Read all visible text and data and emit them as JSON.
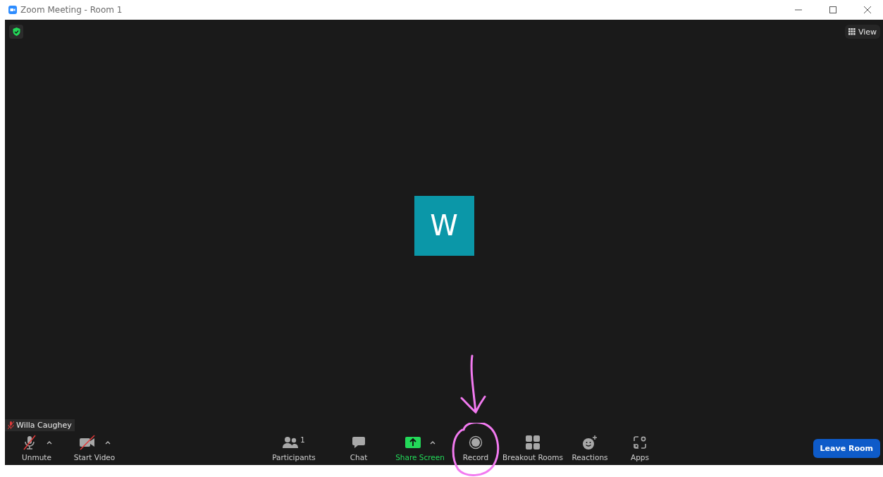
{
  "window": {
    "title": "Zoom Meeting - Room 1"
  },
  "view_button": {
    "label": "View"
  },
  "participant_tile": {
    "initial": "W"
  },
  "name_tag": {
    "name": "Willa Caughey",
    "muted": true
  },
  "toolbar": {
    "left": [
      {
        "kind": "mic",
        "label": "Unmute",
        "off": true,
        "menu": true
      },
      {
        "kind": "video",
        "label": "Start Video",
        "off": true,
        "menu": true
      }
    ],
    "center": [
      {
        "kind": "participants",
        "label": "Participants",
        "count": "1",
        "menu": false
      },
      {
        "kind": "chat",
        "label": "Chat",
        "menu": false
      },
      {
        "kind": "share",
        "label": "Share Screen",
        "menu": true
      },
      {
        "kind": "record",
        "label": "Record",
        "menu": false
      },
      {
        "kind": "breakout",
        "label": "Breakout Rooms",
        "menu": false
      },
      {
        "kind": "reactions",
        "label": "Reactions",
        "menu": false
      },
      {
        "kind": "apps",
        "label": "Apps",
        "menu": false
      }
    ]
  },
  "leave_button": {
    "label": "Leave Room"
  }
}
